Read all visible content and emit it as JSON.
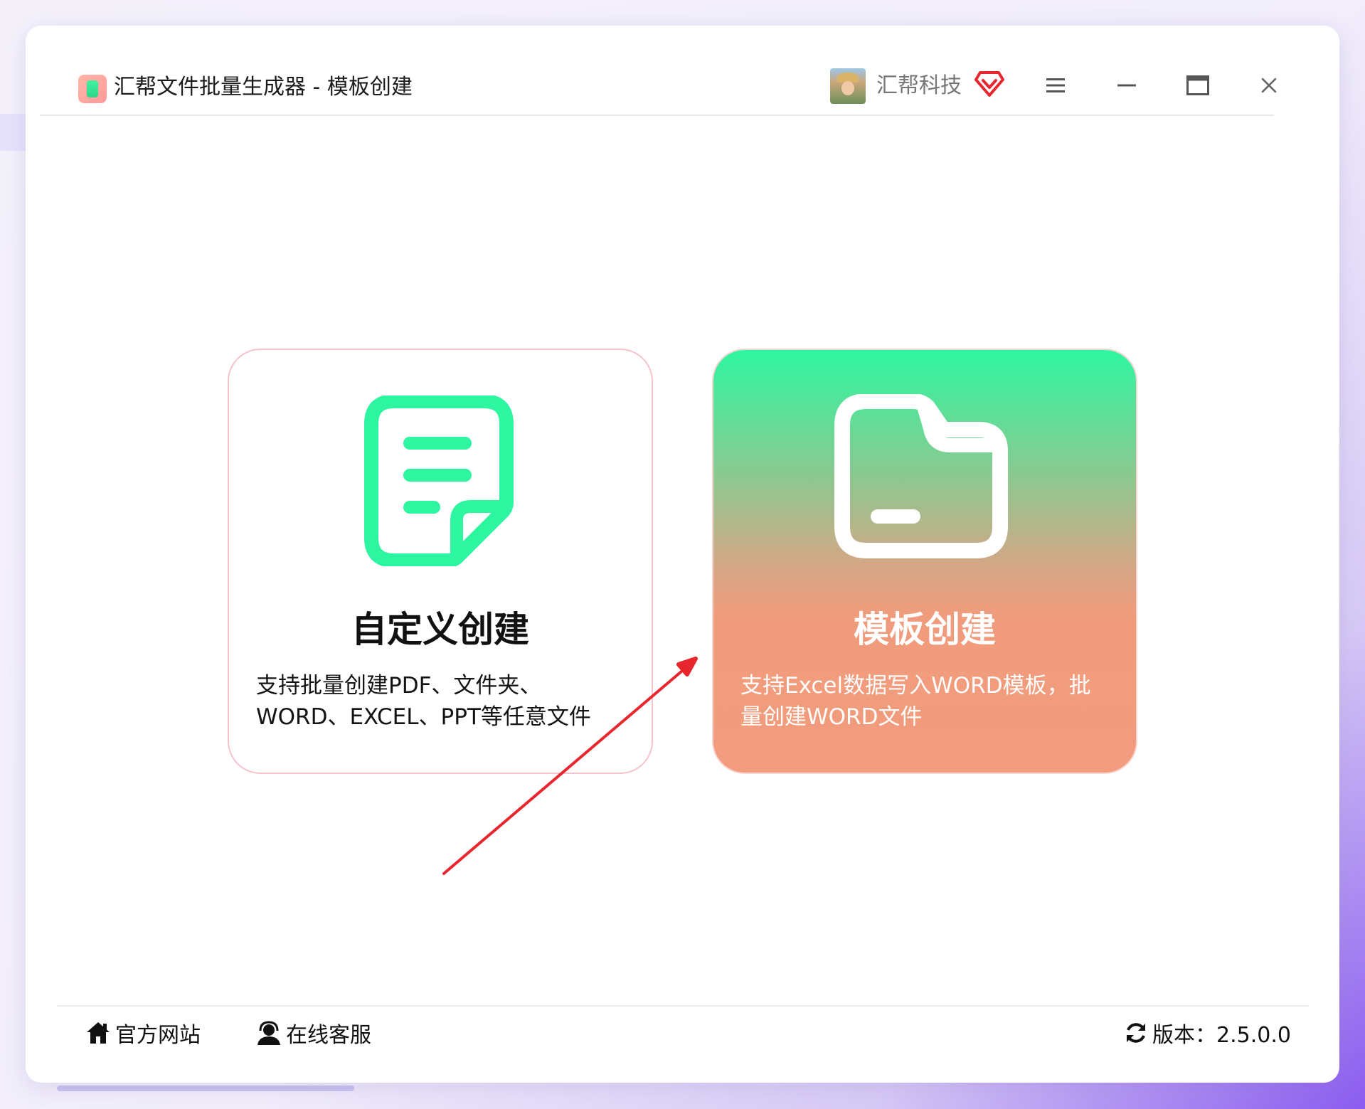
{
  "window": {
    "title": "汇帮文件批量生成器 - 模板创建",
    "user_name": "汇帮科技"
  },
  "cards": {
    "custom": {
      "title": "自定义创建",
      "description_line1": "支持批量创建PDF、文件夹、",
      "description_line2": "WORD、EXCEL、PPT等任意文件"
    },
    "template": {
      "title": "模板创建",
      "description_line1": "支持Excel数据写入WORD模板，批",
      "description_line2": "量创建WORD文件"
    }
  },
  "footer": {
    "website_label": "官方网站",
    "support_label": "在线客服",
    "version_label": "版本：2.5.0.0"
  },
  "icons": {
    "app": "app-logo-icon",
    "vip": "vip-diamond-icon",
    "menu": "hamburger-menu-icon",
    "minimize": "minimize-icon",
    "maximize": "maximize-icon",
    "close": "close-icon",
    "custom_card": "document-icon",
    "template_card": "folder-icon",
    "website": "home-icon",
    "support": "headset-agent-icon",
    "version": "refresh-icon"
  },
  "colors": {
    "accent_green": "#2ef6a0",
    "accent_coral": "#f29b7e",
    "card_border_pink": "#f6c2cb",
    "vip_red": "#e8262e",
    "annotation_arrow": "#e8262e"
  }
}
